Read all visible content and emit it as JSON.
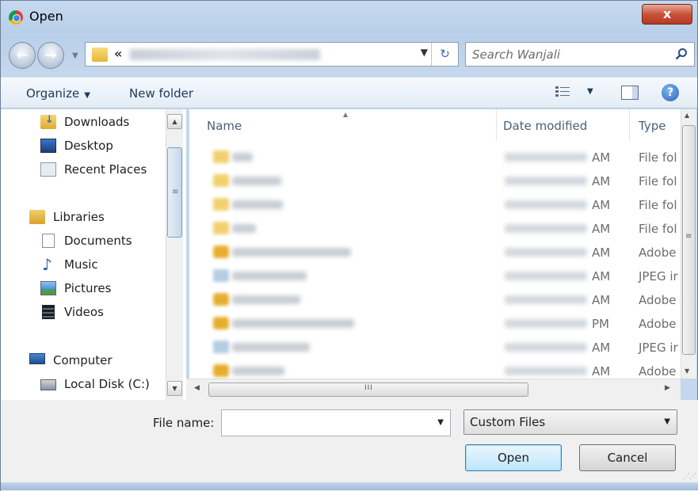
{
  "window": {
    "title": "Open",
    "close_glyph": "x"
  },
  "address": {
    "overflow_glyph": "«",
    "breadcrumb_blurred": true
  },
  "search": {
    "placeholder": "Search Wanjali"
  },
  "toolbar": {
    "organize_label": "Organize",
    "new_folder_label": "New folder"
  },
  "nav_pane": {
    "items": [
      {
        "label": "Downloads",
        "icon": "downloads-icon"
      },
      {
        "label": "Desktop",
        "icon": "desktop-icon"
      },
      {
        "label": "Recent Places",
        "icon": "recent-places-icon"
      },
      {
        "label": "Libraries",
        "icon": "libraries-icon"
      },
      {
        "label": "Documents",
        "icon": "documents-icon"
      },
      {
        "label": "Music",
        "icon": "music-icon"
      },
      {
        "label": "Pictures",
        "icon": "pictures-icon"
      },
      {
        "label": "Videos",
        "icon": "videos-icon"
      },
      {
        "label": "Computer",
        "icon": "computer-icon"
      },
      {
        "label": "Local Disk (C:)",
        "icon": "local-disk-icon"
      }
    ]
  },
  "file_list": {
    "columns": {
      "name": "Name",
      "date_modified": "Date modified",
      "type": "Type"
    },
    "rows": [
      {
        "kind": "folder",
        "ampm": "AM",
        "type": "File fol"
      },
      {
        "kind": "folder",
        "ampm": "AM",
        "type": "File fol"
      },
      {
        "kind": "folder",
        "ampm": "AM",
        "type": "File fol"
      },
      {
        "kind": "folder",
        "ampm": "AM",
        "type": "File fol"
      },
      {
        "kind": "pdf",
        "ampm": "AM",
        "type": "Adobe"
      },
      {
        "kind": "jpeg",
        "ampm": "AM",
        "type": "JPEG ir"
      },
      {
        "kind": "pdf",
        "ampm": "AM",
        "type": "Adobe"
      },
      {
        "kind": "pdf",
        "ampm": "PM",
        "type": "Adobe"
      },
      {
        "kind": "jpeg",
        "ampm": "AM",
        "type": "JPEG ir"
      },
      {
        "kind": "pdf",
        "ampm": "AM",
        "type": "Adobe"
      }
    ],
    "names_and_dates_blurred": true
  },
  "bottom": {
    "file_name_label": "File name:",
    "file_name_value": "",
    "filter_value": "Custom Files",
    "open_label": "Open",
    "cancel_label": "Cancel"
  }
}
